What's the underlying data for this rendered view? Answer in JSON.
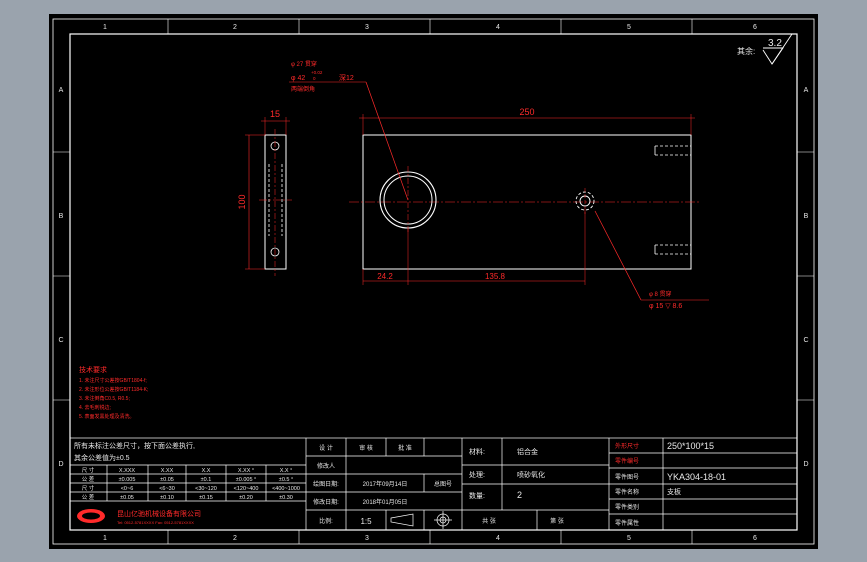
{
  "colors": {
    "background": "#9aa3ad",
    "sheet": "#000000",
    "frame": "#ffffff",
    "dimension": "#ff2a2a"
  },
  "border": {
    "top_labels": [
      "1",
      "2",
      "3",
      "4",
      "5",
      "6"
    ],
    "bottom_labels": [
      "1",
      "2",
      "3",
      "4",
      "5",
      "6"
    ],
    "left_labels": [
      "A",
      "B",
      "C",
      "D"
    ],
    "right_labels": [
      "A",
      "B",
      "C",
      "D"
    ]
  },
  "roughness": {
    "label": "其余:",
    "value": "3.2"
  },
  "dimensions": {
    "side_width": "15",
    "side_height": "100",
    "overall_length": "250",
    "offset_1": "24.2",
    "offset_2": "135.8",
    "callout_top_1": "φ 27 贯穿",
    "callout_top_2": "φ 42",
    "callout_top_tol_up": "+0.02",
    "callout_top_tol_low": "0",
    "callout_top_depth": "深12",
    "callout_top_3": "两端倒角",
    "callout_bot_1": "φ 8 贯穿",
    "callout_bot_2": "φ 15 ▽ 8.6"
  },
  "tech_req": {
    "title": "技术要求",
    "items": [
      "1. 未注尺寸公差按GB/T1804-f;",
      "2. 未注形位公差按GB/T1184-K;",
      "3. 未注倒角C0.5, R0.5;",
      "4. 去毛刺锐边;",
      "5. 表面发黑处理及清洗。"
    ]
  },
  "tolerance_table": {
    "note_line1": "所有未标注公差尺寸，按下面公差执行,",
    "note_line2": "其余公差值为±0.5",
    "header": [
      "尺 寸",
      "X.XXX",
      "X.XX",
      "X.X",
      "X.XX °",
      "X.X °"
    ],
    "row1": [
      "公 差",
      "±0.005",
      "±0.05",
      "±0.1",
      "±0.005 °",
      "±0.5 °"
    ],
    "row2": [
      "尺 寸",
      "<0~6",
      "<6~30",
      "<30~120",
      "<120~400",
      "<400~1000"
    ],
    "row3": [
      "公 差",
      "±0.05",
      "±0.10",
      "±0.15",
      "±0.20",
      "±0.30"
    ]
  },
  "company": {
    "name": "昆山亿驰机械设备有限公司",
    "sub": "Tel: 0512-5781XXXX  Fax: 0512-5781XXXX"
  },
  "sign_block": {
    "r1": [
      "设 计",
      "审 核",
      "批 准"
    ],
    "r2": [
      "绘图日期:",
      "2017年09月14日",
      "总图号"
    ],
    "r3": [
      "修改日期:",
      "2018年01月05日"
    ],
    "r4_label": "比例:",
    "scale": "1:5",
    "r5": [
      "材 料",
      "处 理",
      "数 量"
    ],
    "r6": [
      "张 张",
      "第 张"
    ],
    "name_label": "修改人"
  },
  "mid_block": {
    "material_label": "材料:",
    "material_value": "铝合金",
    "treatment_label": "处理:",
    "treatment_value": "喷砂氧化",
    "qty_label": "数量:",
    "qty_value": "2",
    "bottom": [
      "共 张",
      "第 张"
    ]
  },
  "right_block": {
    "labels": [
      "外形尺寸",
      "零件编号",
      "零件图号",
      "零件名称",
      "零件类别",
      "零件属性"
    ],
    "values": [
      "250*100*15",
      "",
      "YKA304-18-01",
      "支板",
      "",
      ""
    ]
  }
}
